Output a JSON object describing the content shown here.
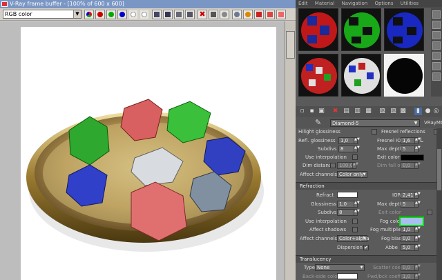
{
  "vfb": {
    "title": "V-Ray frame buffer - [100% of 600 x 600]",
    "channel": "RGB color"
  },
  "menu": [
    "Edit",
    "Material",
    "Navigation",
    "Options",
    "Utilities"
  ],
  "material": {
    "name": "Diamond-5",
    "type": "VRayMtl"
  },
  "reflection": {
    "hilight_glossiness_label": "Hilight glossiness",
    "fresnel_reflections_label": "Fresnel reflections",
    "refl_glossiness_label": "Refl. glossiness",
    "refl_glossiness": "1,0",
    "fresnel_ior_label": "Fresnel IOR",
    "fresnel_ior": "1,6",
    "subdivs_label": "Subdivs",
    "subdivs": "8",
    "max_depth_label": "Max depth",
    "max_depth": "5",
    "use_interp_label": "Use interpolation",
    "exit_color_label": "Exit color",
    "dim_distance_label": "Dim distance",
    "dim_distance": "100,0",
    "dim_falloff_label": "Dim fall off",
    "dim_falloff": "0,0",
    "affect_channels_label": "Affect channels",
    "affect_channels": "Color only"
  },
  "refraction": {
    "header": "Refraction",
    "refract_label": "Refract",
    "ior_label": "IOR",
    "ior": "2,417",
    "glossiness_label": "Glossiness",
    "glossiness": "1,0",
    "max_depth_label": "Max depth",
    "max_depth": "5",
    "subdivs_label": "Subdivs",
    "subdivs": "8",
    "exit_color_label": "Exit color",
    "use_interp_label": "Use interpolation",
    "fog_color_label": "Fog color",
    "affect_shadows_label": "Affect shadows",
    "fog_mult_label": "Fog multiplier",
    "fog_mult": "1,0",
    "affect_channels_label": "Affect channels",
    "affect_channels": "Color+alpha",
    "fog_bias_label": "Fog bias",
    "fog_bias": "0,0",
    "dispersion_label": "Dispersion",
    "dispersion_check": "✔",
    "abbe_label": "Abbe",
    "abbe": "5,0"
  },
  "translucency": {
    "header": "Translucency",
    "type_label": "Type",
    "type": "None",
    "scatter_label": "Scatter coeff",
    "scatter": "0,0",
    "backside_label": "Back-side color",
    "fwd_label": "Fwd/bck coeff",
    "fwd": "1,0"
  },
  "colors": {
    "fog_color": "#a8c0f0",
    "highlight": "#00dd00",
    "refract_color": "#ffffff",
    "exit_color": "#000000"
  }
}
